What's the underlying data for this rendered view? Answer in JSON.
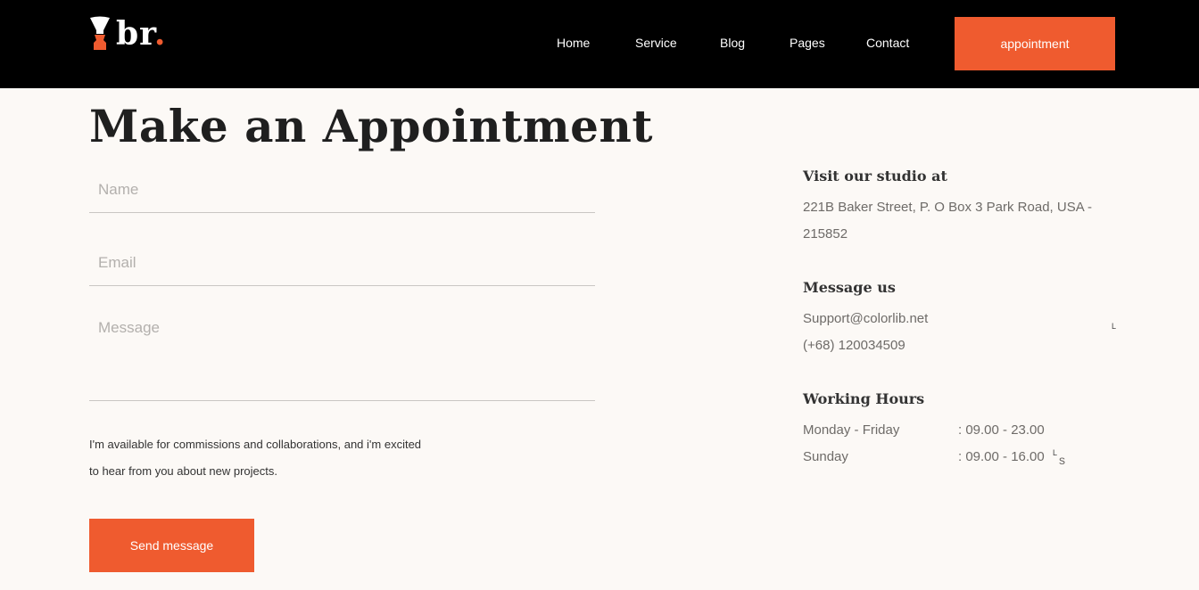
{
  "brand": {
    "logo_text": "br",
    "logo_dot": ".",
    "accent": "#ef5b2f"
  },
  "nav": {
    "items": [
      {
        "label": "Home"
      },
      {
        "label": "Service"
      },
      {
        "label": "Blog"
      },
      {
        "label": "Pages"
      },
      {
        "label": "Contact"
      }
    ],
    "cta_label": "appointment"
  },
  "form": {
    "title": "Make an Appointment",
    "name_placeholder": "Name",
    "email_placeholder": "Email",
    "message_placeholder": "Message",
    "intro_line1": "I'm available for commissions and collaborations, and i'm excited",
    "intro_line2": "to hear from you about new projects.",
    "submit_label": "Send message"
  },
  "info": {
    "studio_heading": "Visit our studio at",
    "studio_address": "221B Baker Street, P. O Box 3 Park Road, USA - 215852",
    "message_heading": "Message us",
    "email": "Support@colorlib.net",
    "phone": "(+68) 120034509",
    "hours_heading": "Working Hours",
    "hours": [
      {
        "day": "Monday - Friday",
        "time": ": 09.00 - 23.00"
      },
      {
        "day": "Sunday",
        "time": ": 09.00 - 16.00"
      }
    ],
    "stray_1": "L",
    "stray_2": "L",
    "stray_3": "s"
  }
}
